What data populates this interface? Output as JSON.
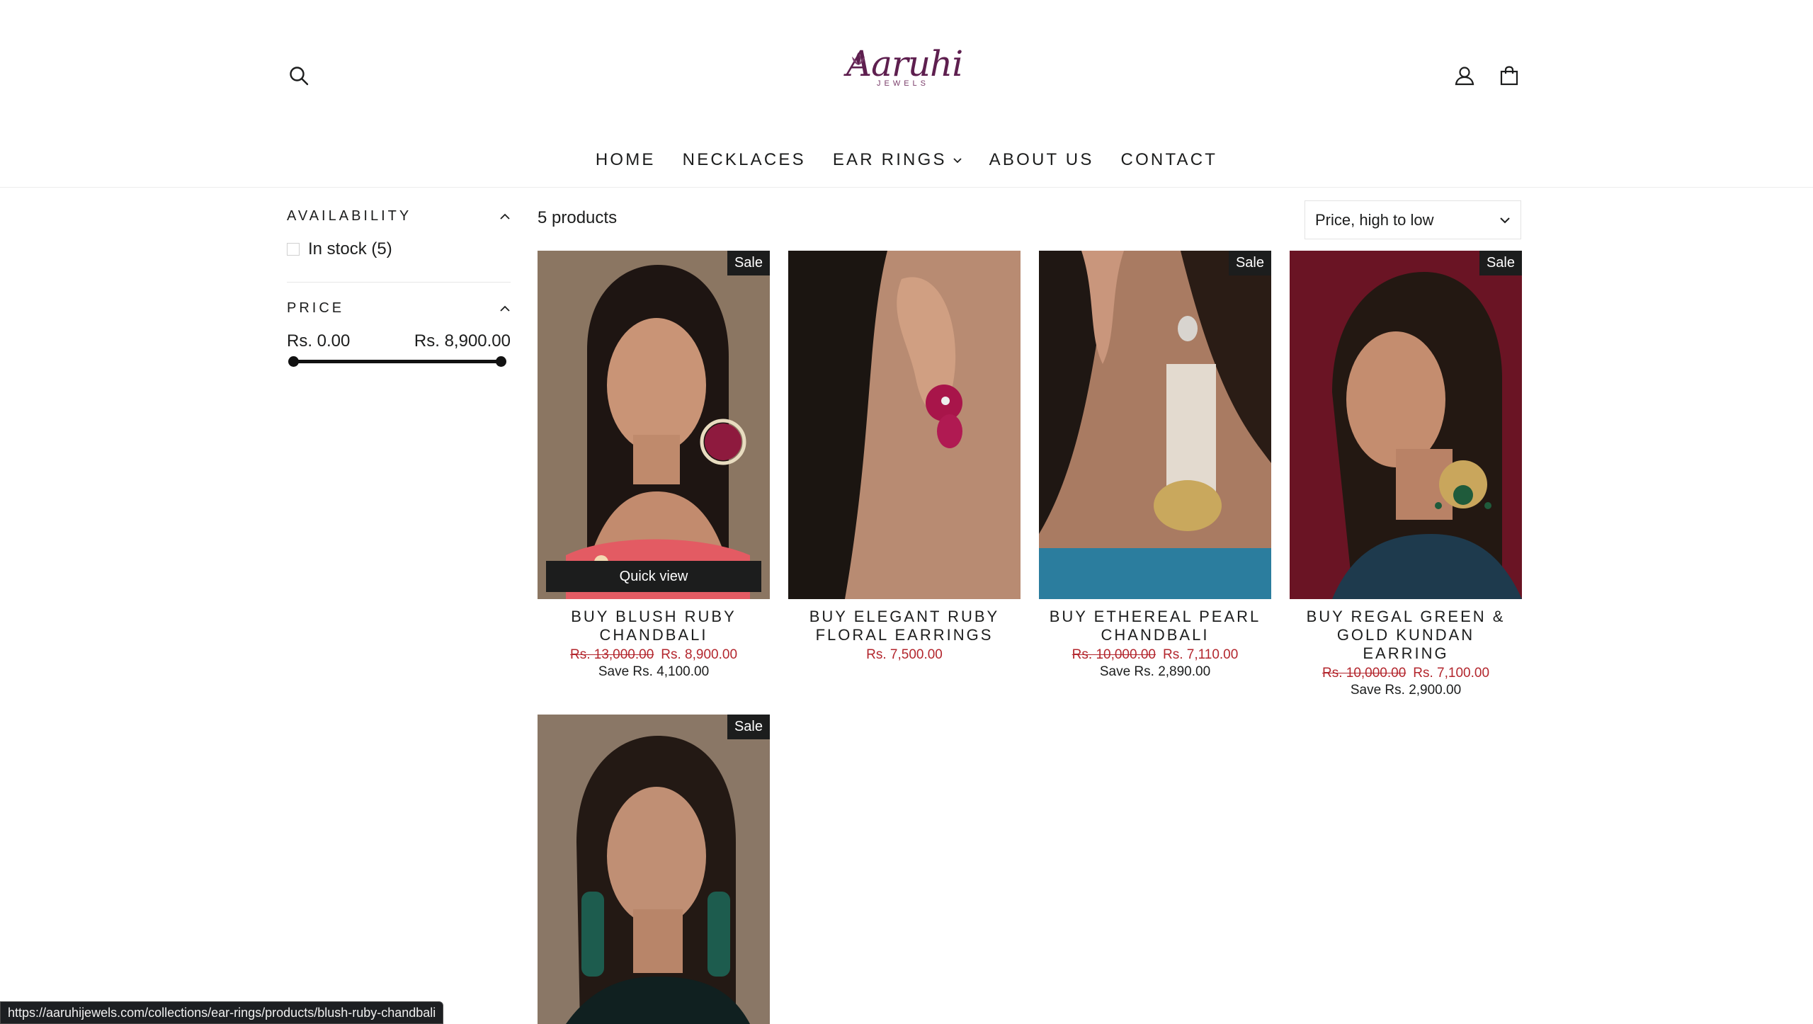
{
  "header": {
    "logo_text": "Aaruhi",
    "logo_sub": "JEWELS"
  },
  "nav": [
    {
      "label": "HOME"
    },
    {
      "label": "NECKLACES"
    },
    {
      "label": "EAR RINGS"
    },
    {
      "label": "ABOUT US"
    },
    {
      "label": "CONTACT"
    }
  ],
  "filters": {
    "availability": {
      "title": "AVAILABILITY",
      "in_stock_label": "In stock (5)"
    },
    "price": {
      "title": "PRICE",
      "min": "Rs. 0.00",
      "max": "Rs. 8,900.00",
      "range_fraction": [
        0,
        1
      ]
    }
  },
  "collection": {
    "count_label": "5 products",
    "sort_selected": "Price, high to low"
  },
  "products": [
    {
      "title": "BUY BLUSH RUBY CHANDBALI",
      "badge": "Sale",
      "old_price": "Rs. 13,000.00",
      "price": "Rs. 8,900.00",
      "save": "Save Rs. 4,100.00",
      "quick_view": "Quick view"
    },
    {
      "title": "BUY ELEGANT RUBY FLORAL EARRINGS",
      "badge": "",
      "old_price": "",
      "price": "Rs. 7,500.00",
      "save": ""
    },
    {
      "title": "BUY ETHEREAL PEARL CHANDBALI",
      "badge": "Sale",
      "old_price": "Rs. 10,000.00",
      "price": "Rs. 7,110.00",
      "save": "Save Rs. 2,890.00"
    },
    {
      "title": "BUY REGAL GREEN & GOLD KUNDAN EARRING",
      "badge": "Sale",
      "old_price": "Rs. 10,000.00",
      "price": "Rs. 7,100.00",
      "save": "Save Rs. 2,900.00"
    },
    {
      "title": "",
      "badge": "Sale",
      "old_price": "",
      "price": "",
      "save": ""
    }
  ],
  "status_bar": {
    "url": "https://aaruhijewels.com/collections/ear-rings/products/blush-ruby-chandbali"
  },
  "colors": {
    "sale_price": "#b3262d",
    "badge_bg": "#1c1d1d",
    "logo": "#5e1f4f"
  }
}
